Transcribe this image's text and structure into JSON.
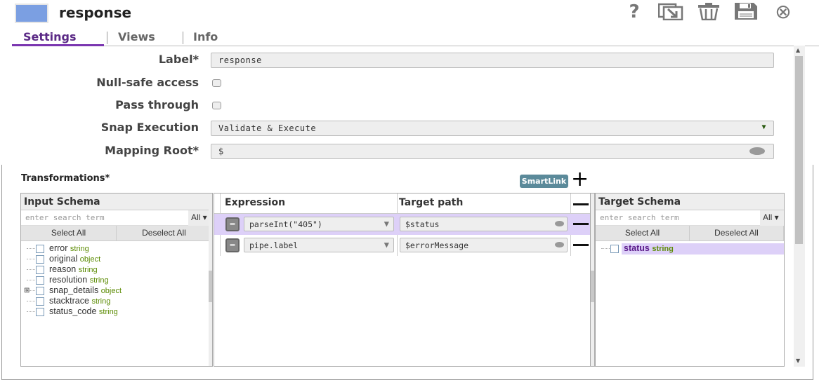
{
  "header": {
    "title": "response",
    "icons": [
      "help-icon",
      "export-icon",
      "trash-icon",
      "save-icon",
      "close-icon"
    ],
    "help_glyph": "?",
    "close_glyph": "⊗"
  },
  "tabs": [
    "Settings",
    "Views",
    "Info"
  ],
  "form": {
    "label": {
      "label": "Label*",
      "value": "response"
    },
    "null_safe": {
      "label": "Null-safe access",
      "checked": false
    },
    "pass_through": {
      "label": "Pass through",
      "checked": false
    },
    "snap_execution": {
      "label": "Snap Execution",
      "value": "Validate & Execute"
    },
    "mapping_root": {
      "label": "Mapping Root*",
      "value": "$"
    }
  },
  "transformations": {
    "title": "Transformations*",
    "smartlink": "SmartLink",
    "add_glyph": "+"
  },
  "input_schema": {
    "title": "Input Schema",
    "placeholder": "enter search term",
    "filter": "All",
    "select_all": "Select All",
    "deselect_all": "Deselect All",
    "items": [
      {
        "name": "error",
        "type": "string"
      },
      {
        "name": "original",
        "type": "object"
      },
      {
        "name": "reason",
        "type": "string"
      },
      {
        "name": "resolution",
        "type": "string"
      },
      {
        "name": "snap_details",
        "type": "object",
        "expandable": true
      },
      {
        "name": "stacktrace",
        "type": "string"
      },
      {
        "name": "status_code",
        "type": "string"
      }
    ]
  },
  "mapping": {
    "expression_header": "Expression",
    "target_header": "Target path",
    "eq": "=",
    "rows": [
      {
        "expression": "parseInt(\"405\")",
        "target": "$status",
        "selected": true
      },
      {
        "expression": "pipe.label",
        "target": "$errorMessage",
        "selected": false
      }
    ]
  },
  "target_schema": {
    "title": "Target Schema",
    "placeholder": "enter search term",
    "filter": "All",
    "select_all": "Select All",
    "deselect_all": "Deselect All",
    "items": [
      {
        "name": "status",
        "type": "string",
        "highlighted": true
      }
    ]
  },
  "colors": {
    "accent": "#7a35b0",
    "highlight": "#ddd0f8",
    "swatch": "#7b9fe2",
    "smartlink": "#5b8a9a"
  }
}
